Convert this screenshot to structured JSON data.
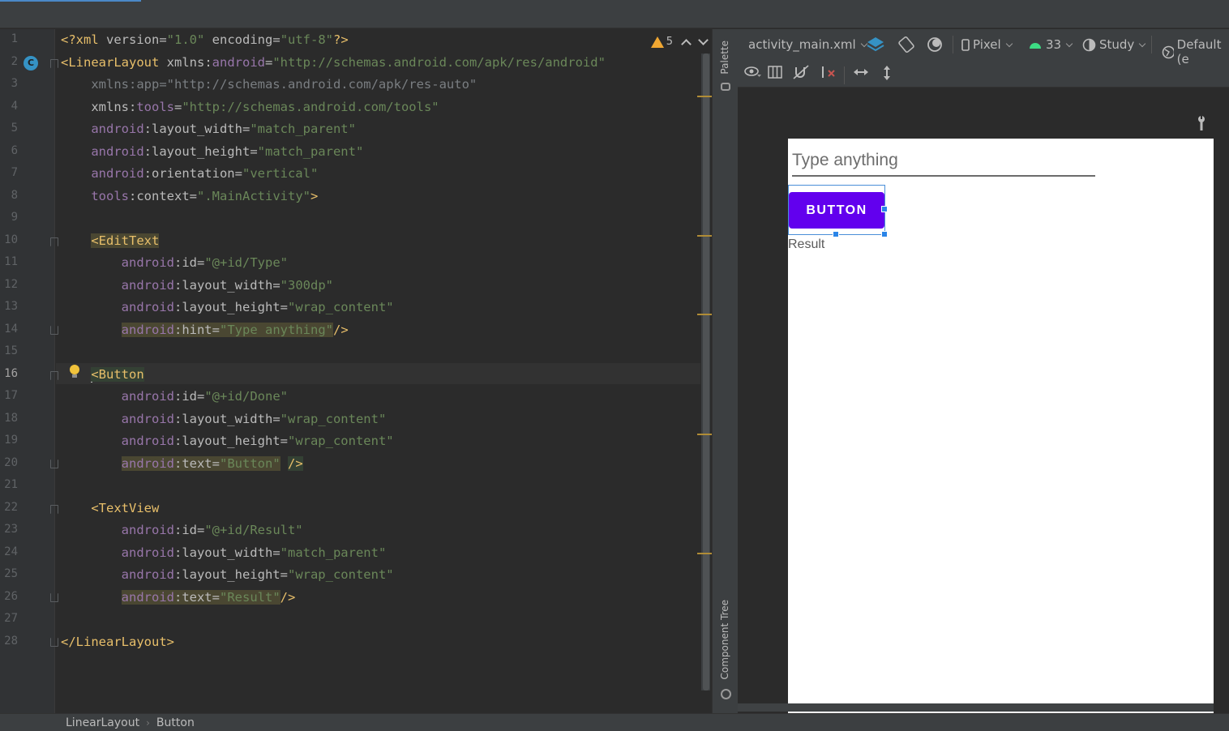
{
  "editor": {
    "gutter_badge": "C",
    "current_line": 16,
    "warnings_count": "5",
    "line_numbers": [
      "1",
      "2",
      "3",
      "4",
      "5",
      "6",
      "7",
      "8",
      "9",
      "10",
      "11",
      "12",
      "13",
      "14",
      "15",
      "16",
      "17",
      "18",
      "19",
      "20",
      "21",
      "22",
      "23",
      "24",
      "25",
      "26",
      "27",
      "28"
    ],
    "code": {
      "l1": {
        "a": "<?xml ",
        "b": "version",
        "c": "=",
        "d": "\"1.0\"",
        "e": " encoding",
        "f": "=",
        "g": "\"utf-8\"",
        "h": "?>"
      },
      "l2": {
        "a": "<LinearLayout ",
        "b": "xmlns:",
        "c": "android",
        "d": "=",
        "e": "\"http://schemas.android.com/apk/res/android\""
      },
      "l3": {
        "a": "    xmlns:app=\"http://schemas.android.com/apk/res-auto\""
      },
      "l4": {
        "a": "    xmlns:",
        "b": "tools",
        "c": "=",
        "d": "\"http://schemas.android.com/tools\""
      },
      "l5": {
        "a": "    ",
        "b": "android",
        "c": ":layout_width",
        "d": "=",
        "e": "\"match_parent\""
      },
      "l6": {
        "a": "    ",
        "b": "android",
        "c": ":layout_height",
        "d": "=",
        "e": "\"match_parent\""
      },
      "l7": {
        "a": "    ",
        "b": "android",
        "c": ":orientation",
        "d": "=",
        "e": "\"vertical\""
      },
      "l8": {
        "a": "    ",
        "b": "tools",
        "c": ":context",
        "d": "=",
        "e": "\".MainActivity\"",
        "f": ">"
      },
      "l10": {
        "a": "    ",
        "b": "<EditText"
      },
      "l11": {
        "a": "        ",
        "b": "android",
        "c": ":id",
        "d": "=",
        "e": "\"@+id/Type\""
      },
      "l12": {
        "a": "        ",
        "b": "android",
        "c": ":layout_width",
        "d": "=",
        "e": "\"300dp\""
      },
      "l13": {
        "a": "        ",
        "b": "android",
        "c": ":layout_height",
        "d": "=",
        "e": "\"wrap_content\""
      },
      "l14": {
        "a": "        ",
        "b": "android",
        "c": ":hint",
        "d": "=",
        "e": "\"Type anything\"",
        "f": "/>"
      },
      "l16": {
        "a": "    ",
        "b": "<Button"
      },
      "l17": {
        "a": "        ",
        "b": "android",
        "c": ":id",
        "d": "=",
        "e": "\"@+id/Done\""
      },
      "l18": {
        "a": "        ",
        "b": "android",
        "c": ":layout_width",
        "d": "=",
        "e": "\"wrap_content\""
      },
      "l19": {
        "a": "        ",
        "b": "android",
        "c": ":layout_height",
        "d": "=",
        "e": "\"wrap_content\""
      },
      "l20": {
        "a": "        ",
        "b": "android",
        "c": ":text",
        "d": "=",
        "e": "\"Button\"",
        "f": " ",
        "g": "/>"
      },
      "l22": {
        "a": "    ",
        "b": "<TextView"
      },
      "l23": {
        "a": "        ",
        "b": "android",
        "c": ":id",
        "d": "=",
        "e": "\"@+id/Result\""
      },
      "l24": {
        "a": "        ",
        "b": "android",
        "c": ":layout_width",
        "d": "=",
        "e": "\"match_parent\""
      },
      "l25": {
        "a": "        ",
        "b": "android",
        "c": ":layout_height",
        "d": "=",
        "e": "\"wrap_content\""
      },
      "l26": {
        "a": "        ",
        "b": "android",
        "c": ":text",
        "d": "=",
        "e": "\"Result\"",
        "f": "/>"
      },
      "l28": {
        "a": "</LinearLayout>"
      }
    }
  },
  "side_panels": {
    "palette": "Palette",
    "component_tree": "Component Tree"
  },
  "design_toolbar": {
    "file": "activity_main.xml",
    "device": "Pixel",
    "api": "33",
    "theme": "Study",
    "locale": "Default (e"
  },
  "preview": {
    "edit_hint": "Type anything",
    "button_text": "BUTTON",
    "result_text": "Result",
    "button_color": "#6200ee"
  },
  "breadcrumb": {
    "items": [
      "LinearLayout",
      "Button"
    ]
  },
  "colors": {
    "tag": "#e8bf6a",
    "namespace": "#9876aa",
    "value": "#6a8759",
    "accent": "#4a88c7"
  }
}
